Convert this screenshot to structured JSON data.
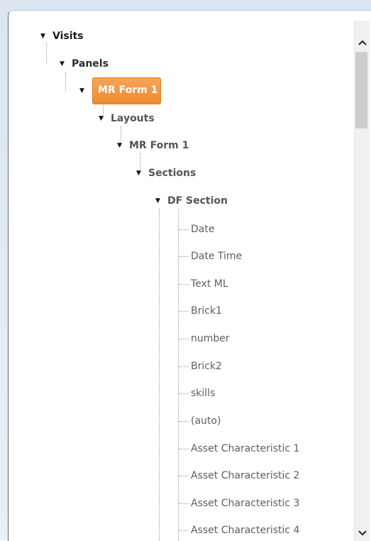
{
  "tree": {
    "root": {
      "label": "Visits"
    },
    "panels": {
      "label": "Panels"
    },
    "selected_form": {
      "label": "MR Form 1"
    },
    "layouts": {
      "label": "Layouts"
    },
    "layout_form": {
      "label": "MR Form 1"
    },
    "sections": {
      "label": "Sections"
    },
    "df_section": {
      "label": "DF Section"
    },
    "fields": [
      "Date",
      "Date Time",
      "Text ML",
      "Brick1",
      "number",
      "Brick2",
      "skills",
      "(auto)",
      "Asset Characteristic 1",
      "Asset Characteristic 2",
      "Asset Characteristic 3",
      "Asset Characteristic 4"
    ]
  },
  "colors": {
    "selection": "#f39a45",
    "selection_text": "#ffffff"
  },
  "icons": {
    "expander": "triangle-down",
    "scroll_up": "chevron-up",
    "scroll_down": "chevron-down"
  }
}
